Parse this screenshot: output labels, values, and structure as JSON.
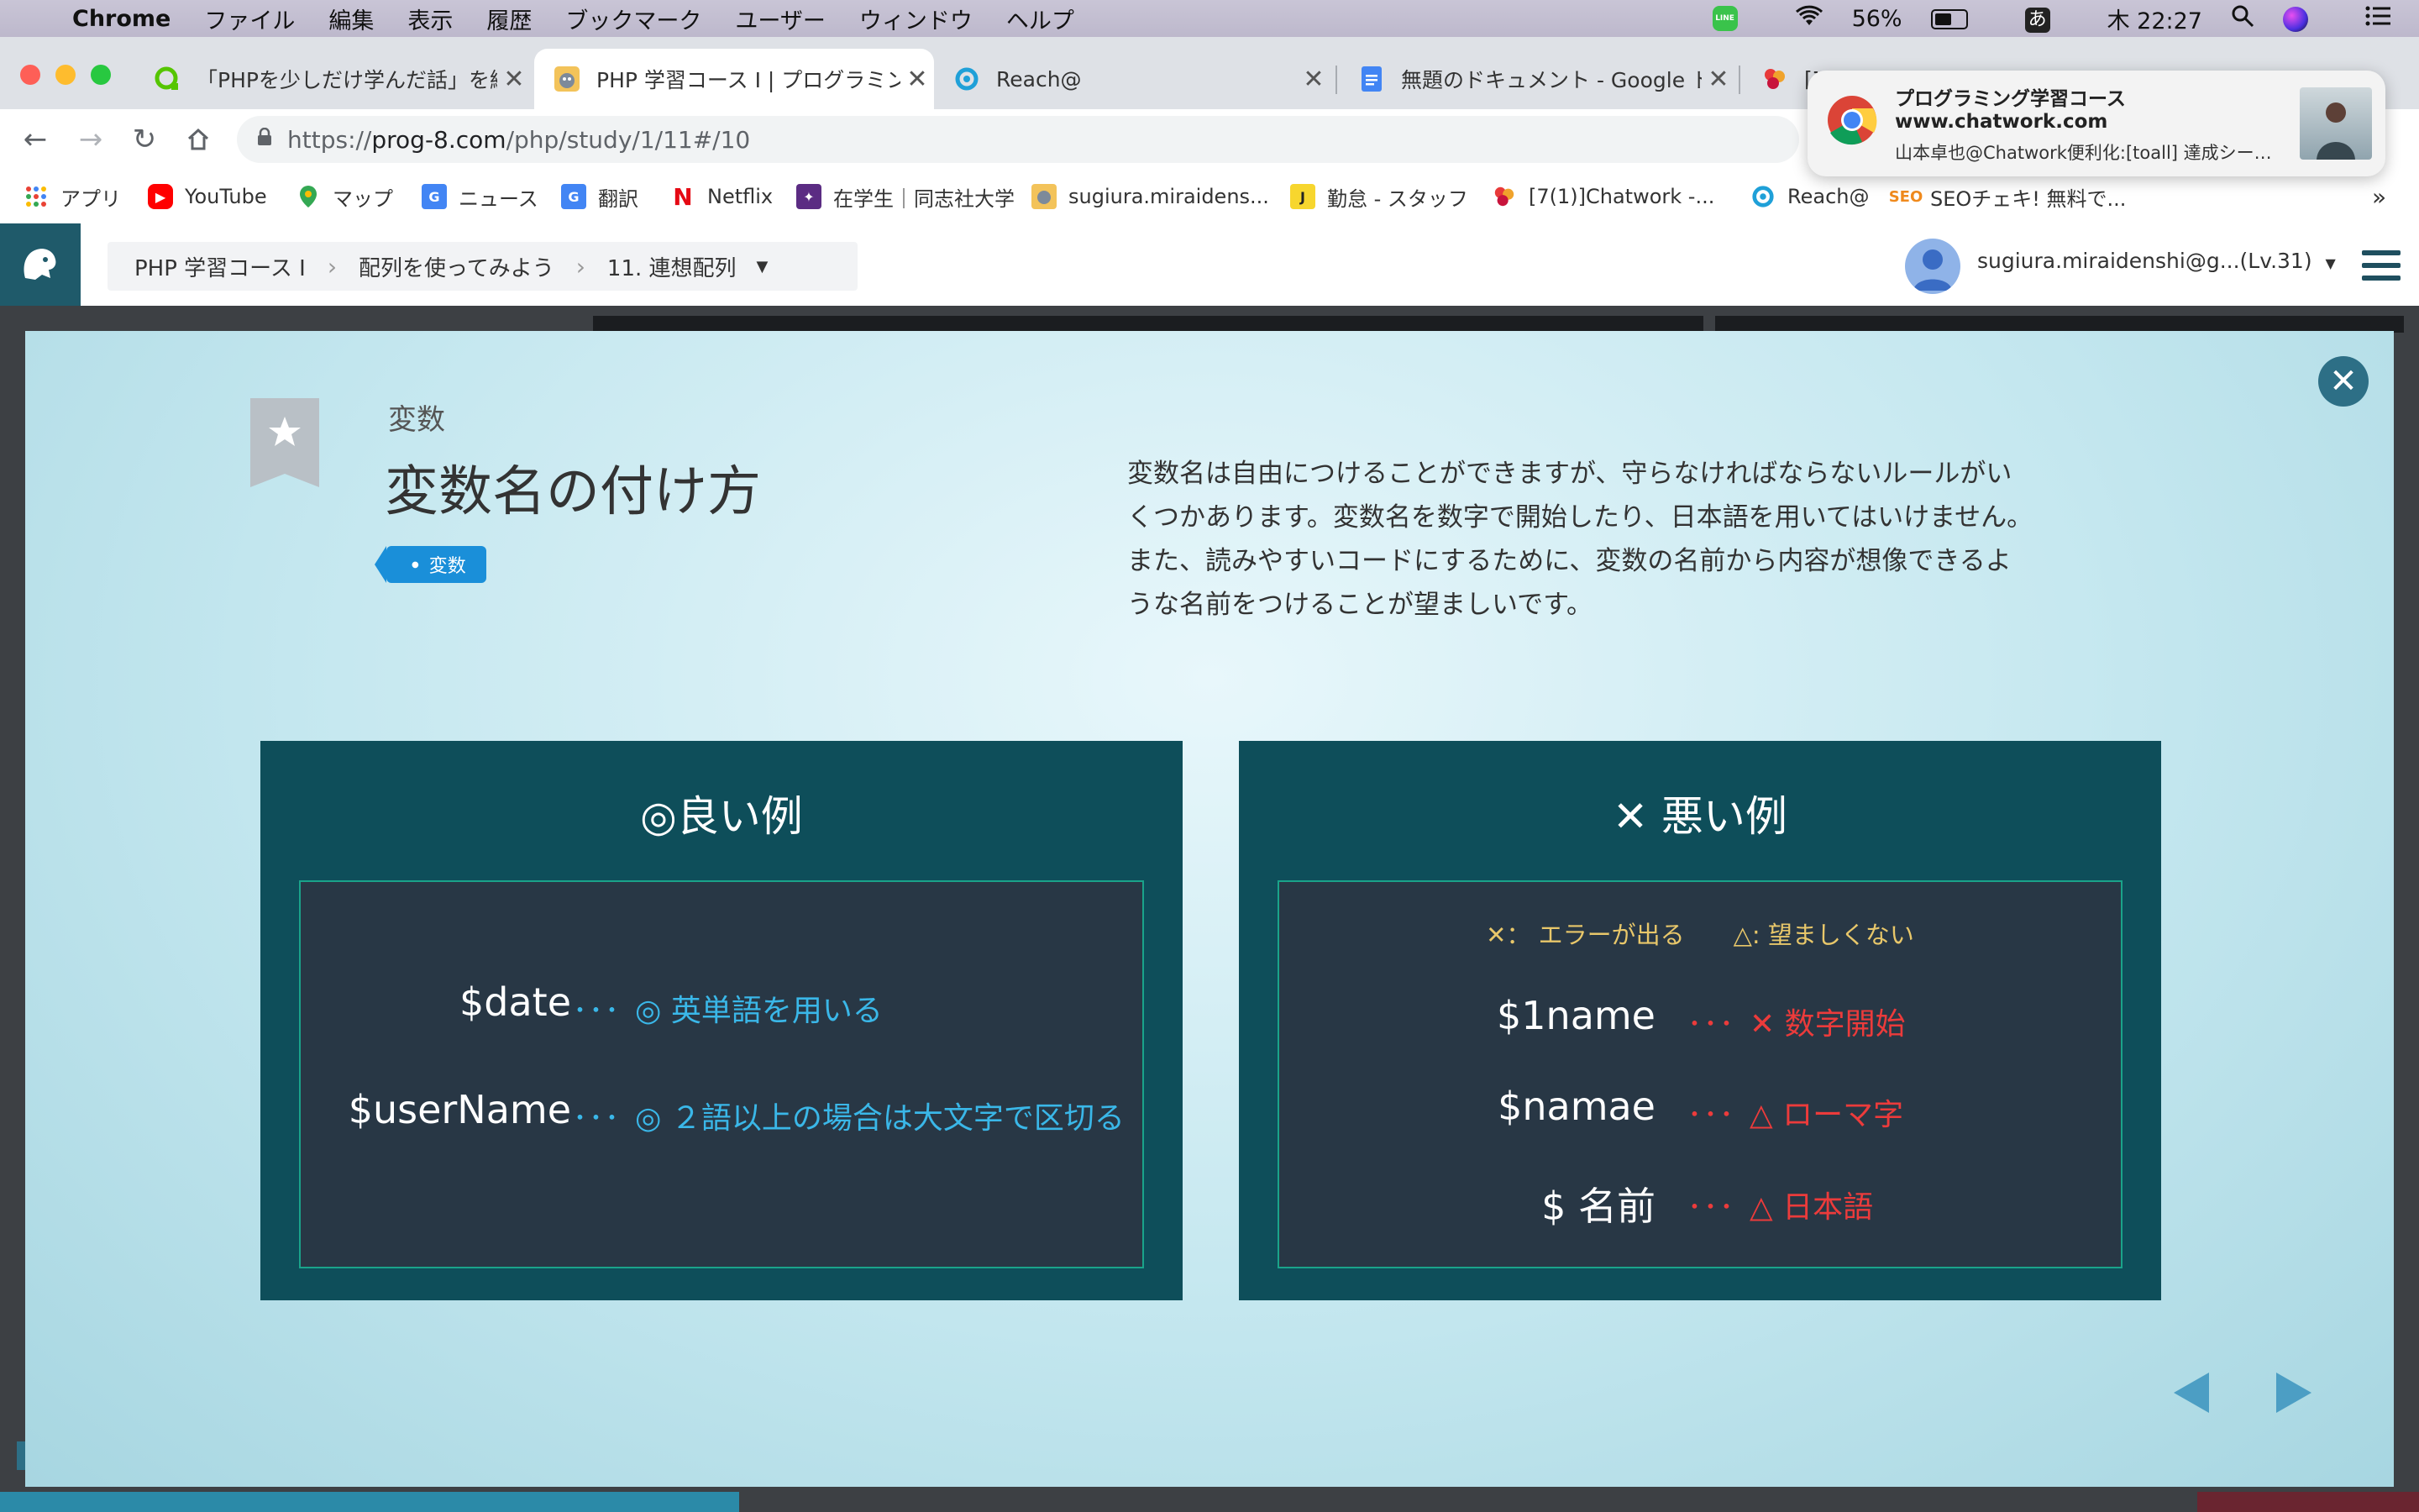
{
  "menubar": {
    "app": "Chrome",
    "items": [
      "ファイル",
      "編集",
      "表示",
      "履歴",
      "ブックマーク",
      "ユーザー",
      "ウィンドウ",
      "ヘルプ"
    ],
    "line_label": "LINE",
    "battery": "56%",
    "ime": "あ",
    "clock": "木 22:27"
  },
  "tabs": [
    {
      "title": "「PHPを少しだけ学んだ話」を編集",
      "active": false
    },
    {
      "title": "PHP 学習コース I | プログラミング",
      "active": true
    },
    {
      "title": "Reach@",
      "active": false
    },
    {
      "title": "無題のドキュメント - Google ドキ",
      "active": false
    },
    {
      "title": "[7",
      "active": false
    }
  ],
  "omnibox": {
    "url_prefix": "https://",
    "url_host": "prog-8.com",
    "url_path": "/php/study/1/11#/10"
  },
  "bookmarks": [
    {
      "label": "アプリ"
    },
    {
      "label": "YouTube"
    },
    {
      "label": "マップ"
    },
    {
      "label": "ニュース"
    },
    {
      "label": "翻訳"
    },
    {
      "label": "Netflix"
    },
    {
      "label": "在学生｜同志社大学"
    },
    {
      "label": "sugiura.miraidens..."
    },
    {
      "label": "勤怠 - スタッフ"
    },
    {
      "label": "[7(1)]Chatwork -..."
    },
    {
      "label": "Reach@"
    },
    {
      "label": "SEOチェキ! 無料で..."
    }
  ],
  "bookmarks_more": "»",
  "notification": {
    "title": "プログラミング学習コース",
    "site": "www.chatwork.com",
    "body": "山本卓也@Chatwork便利化:[toall] 達成シー…"
  },
  "site": {
    "breadcrumb": [
      "PHP 学習コース Ⅰ",
      "配列を使ってみよう",
      "11. 連想配列"
    ],
    "user": "sugiura.miraidenshi@g...(Lv.31)"
  },
  "slide": {
    "category": "変数",
    "title": "変数名の付け方",
    "tag": "変数",
    "description_lines": [
      "変数名は自由につけることができますが、守らなければならないルールがい",
      "くつかあります。変数名を数字で開始したり、日本語を用いてはいけません。",
      "また、読みやすいコードにするために、変数の名前から内容が想像できるよ",
      "うな名前をつけることが望ましいです。"
    ],
    "good": {
      "title": "◎良い例",
      "rows": [
        {
          "code": "$date",
          "dots": "･･･",
          "note": "◎ 英単語を用いる"
        },
        {
          "code": "$userName",
          "dots": "･･･",
          "note": "◎ ２語以上の場合は大文字で区切る"
        }
      ]
    },
    "bad": {
      "title": "✕ 悪い例",
      "legend": "✕： エラーが出る　　△: 望ましくない",
      "rows": [
        {
          "code": "$1name",
          "dots": "･･･",
          "note": "✕ 数字開始"
        },
        {
          "code": "$namae",
          "dots": "･･･",
          "note": "△ ローマ字"
        },
        {
          "code": "$ 名前",
          "dots": "･･･",
          "note": "△ 日本語"
        }
      ]
    }
  },
  "colors": {
    "card_bg": "#0e4e5a",
    "inner_bg": "#283745",
    "good_text": "#3ab7e8",
    "bad_text": "#ec3b3b",
    "legend_text": "#e8c76a",
    "tag_bg": "#1a8fd9"
  }
}
